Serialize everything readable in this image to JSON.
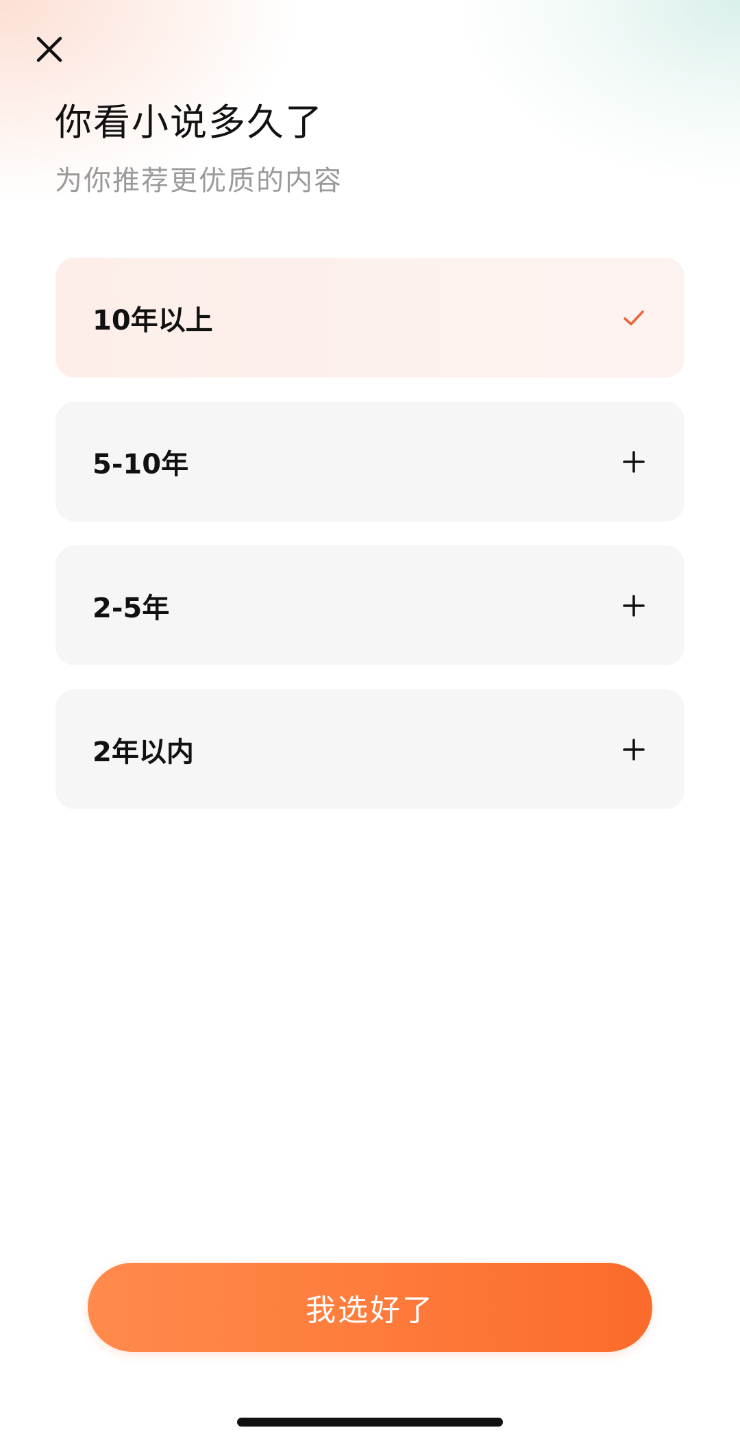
{
  "header": {
    "close_icon": "close-icon",
    "title": "你看小说多久了",
    "subtitle": "为你推荐更优质的内容"
  },
  "options": [
    {
      "label": "10年以上",
      "selected": true,
      "icon": "check-icon"
    },
    {
      "label": "5-10年",
      "selected": false,
      "icon": "plus-icon"
    },
    {
      "label": "2-5年",
      "selected": false,
      "icon": "plus-icon"
    },
    {
      "label": "2年以内",
      "selected": false,
      "icon": "plus-icon"
    }
  ],
  "submit": {
    "label": "我选好了"
  },
  "colors": {
    "accent": "#fb7436",
    "check": "#e8653a",
    "option_bg": "#f6f6f6",
    "selected_bg": "#fdeee9",
    "subtitle": "#9a9a9a"
  }
}
